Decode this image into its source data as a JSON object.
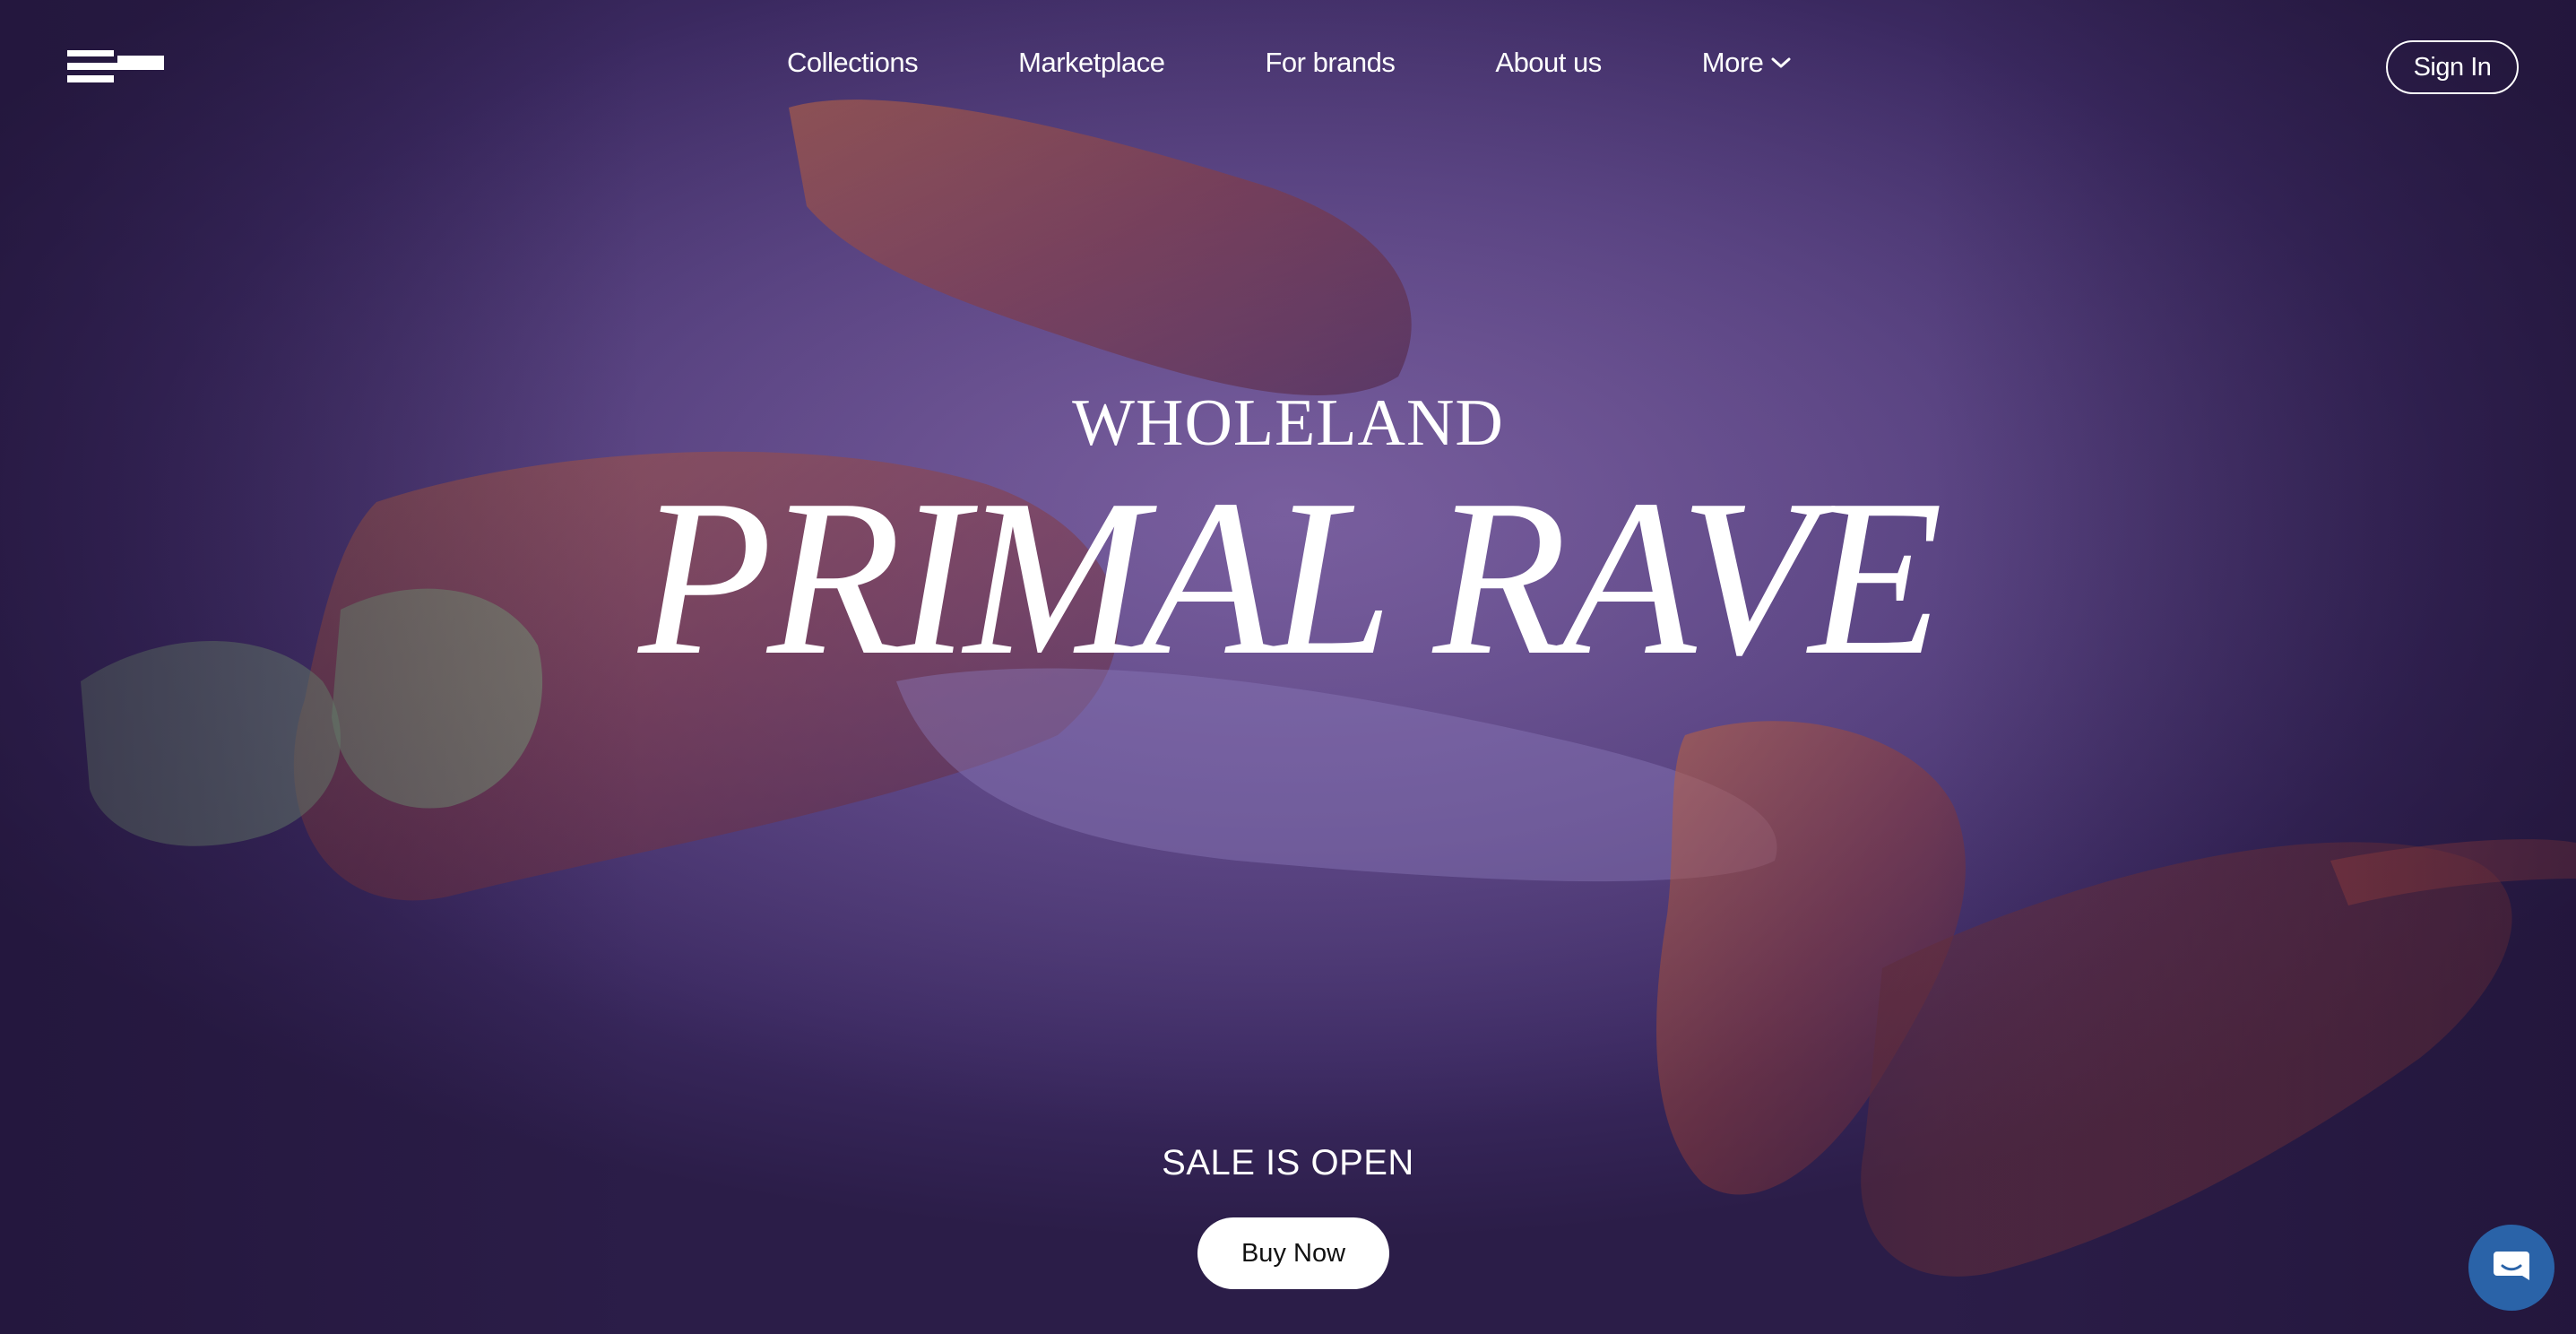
{
  "header": {
    "logo_icon": "brand-logo-icon",
    "nav": [
      {
        "label": "Collections"
      },
      {
        "label": "Marketplace"
      },
      {
        "label": "For brands"
      },
      {
        "label": "About us"
      },
      {
        "label": "More",
        "icon": "chevron-down-icon"
      }
    ],
    "signin_label": "Sign In"
  },
  "hero": {
    "brand": "WHOLELAND",
    "title": "PRIMAL RAVE",
    "sale_text": "SALE IS OPEN",
    "buy_label": "Buy Now"
  },
  "chat": {
    "icon": "chat-bubble-icon",
    "color": "#2a63a8"
  },
  "colors": {
    "background": "#4f3a78",
    "accent_fabric": "#b0503a",
    "text": "#ffffff"
  }
}
